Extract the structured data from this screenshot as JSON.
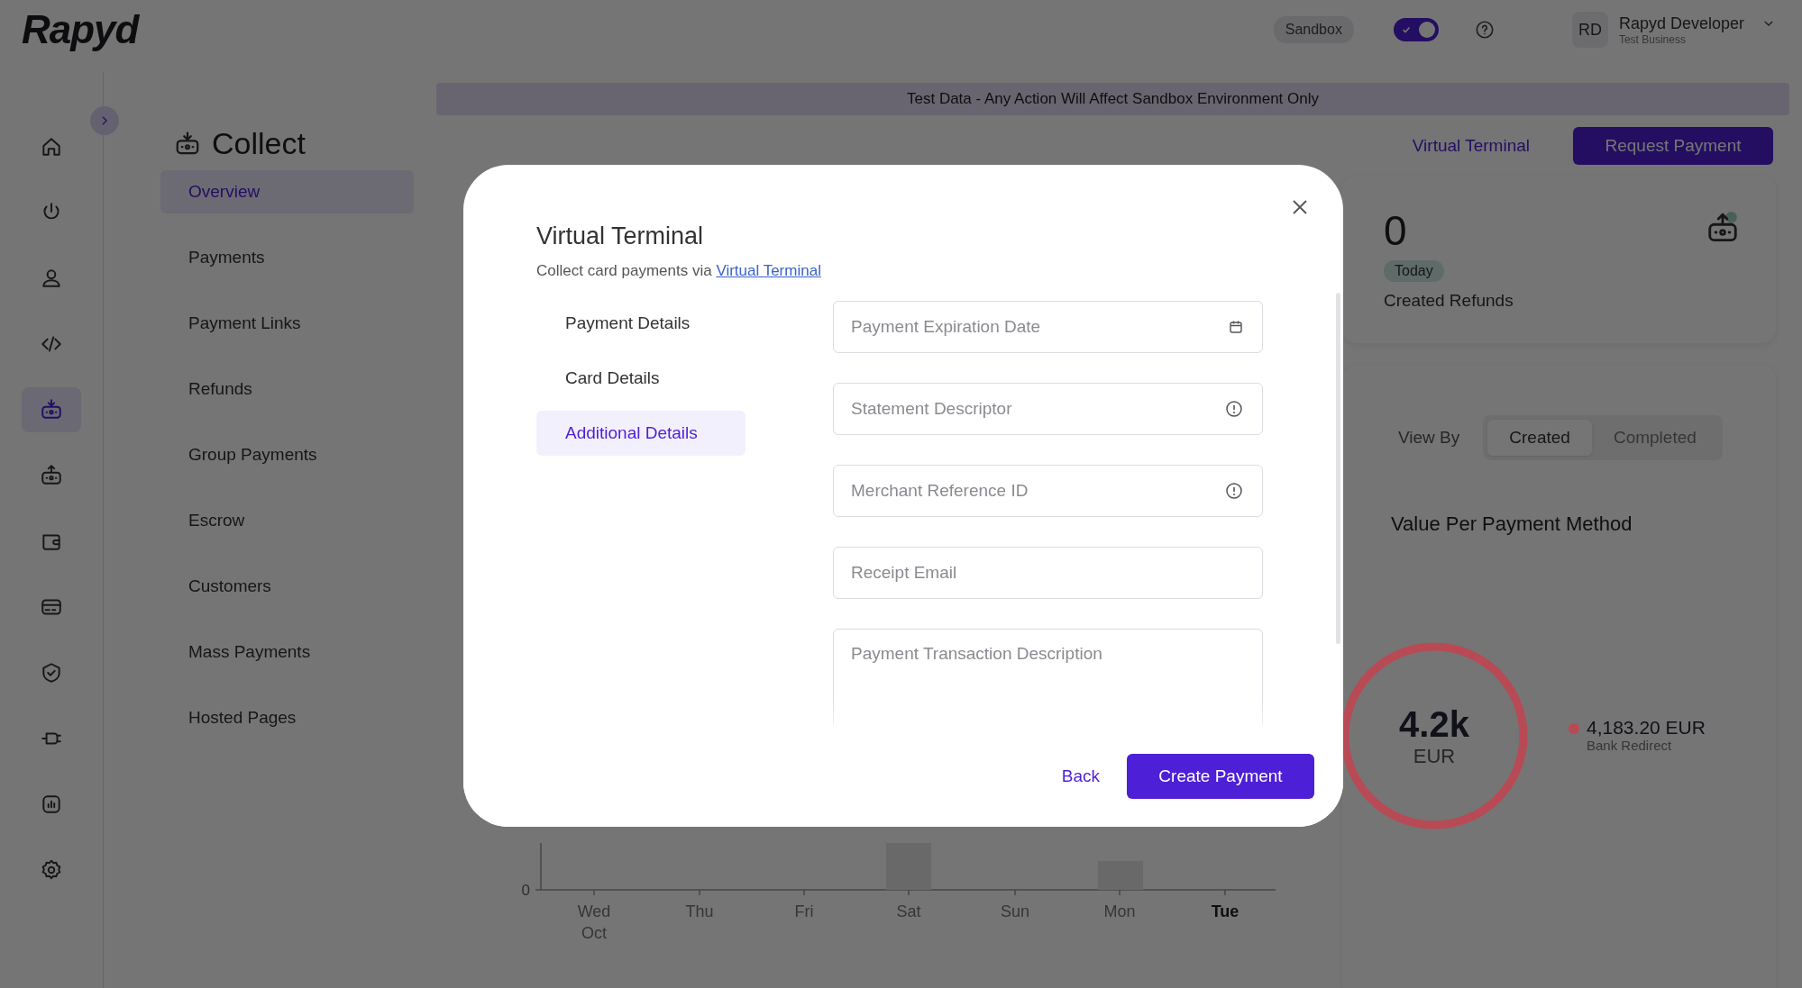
{
  "header": {
    "logo": "Rapyd",
    "environment_badge": "Sandbox",
    "sandbox_toggle": {
      "on": true
    },
    "user": {
      "initials": "RD",
      "name": "Rapyd Developer",
      "business": "Test Business"
    }
  },
  "nav_rail": {
    "items": [
      {
        "kind": "home",
        "selected": false
      },
      {
        "kind": "power",
        "selected": false
      },
      {
        "kind": "user",
        "selected": false
      },
      {
        "kind": "code",
        "selected": false
      },
      {
        "kind": "collect",
        "selected": true
      },
      {
        "kind": "disburse",
        "selected": false
      },
      {
        "kind": "wallet",
        "selected": false
      },
      {
        "kind": "card",
        "selected": false
      },
      {
        "kind": "shield",
        "selected": false
      },
      {
        "kind": "plug",
        "selected": false
      },
      {
        "kind": "report",
        "selected": false
      },
      {
        "kind": "settings",
        "selected": false
      }
    ]
  },
  "sidebar": {
    "title": "Collect",
    "items": [
      {
        "label": "Overview",
        "selected": true
      },
      {
        "label": "Payments",
        "selected": false
      },
      {
        "label": "Payment Links",
        "selected": false
      },
      {
        "label": "Refunds",
        "selected": false
      },
      {
        "label": "Group Payments",
        "selected": false
      },
      {
        "label": "Escrow",
        "selected": false
      },
      {
        "label": "Customers",
        "selected": false
      },
      {
        "label": "Mass Payments",
        "selected": false
      },
      {
        "label": "Hosted Pages",
        "selected": false
      }
    ]
  },
  "banner": "Test Data - Any Action Will Affect Sandbox Environment Only",
  "page_actions": {
    "link": "Virtual Terminal",
    "button": "Request Payment"
  },
  "refunds_card": {
    "value": "0",
    "badge": "Today",
    "label": "Created Refunds"
  },
  "view_by": {
    "label": "View By",
    "options": [
      {
        "label": "Created",
        "selected": true
      },
      {
        "label": "Completed",
        "selected": false
      }
    ]
  },
  "payment_method": {
    "title": "Value Per Payment Method",
    "total": "4.2k",
    "currency": "EUR",
    "legend": [
      {
        "amount": "4,183.20 EUR",
        "method": "Bank Redirect",
        "color": "#b84a55"
      }
    ]
  },
  "activity_chart": {
    "axis_label": "0",
    "days": [
      {
        "label": "Wed",
        "sub": "Oct",
        "current": false
      },
      {
        "label": "Thu",
        "current": false
      },
      {
        "label": "Fri",
        "current": false
      },
      {
        "label": "Sat",
        "current": false
      },
      {
        "label": "Sun",
        "current": false
      },
      {
        "label": "Mon",
        "current": false
      },
      {
        "label": "Tue",
        "current": true
      }
    ]
  },
  "modal": {
    "title": "Virtual Terminal",
    "subtitle": "Collect card payments via",
    "subtitle_link": "Virtual Terminal",
    "steps": [
      {
        "label": "Payment Details",
        "selected": false
      },
      {
        "label": "Card Details",
        "selected": false
      },
      {
        "label": "Additional Details",
        "selected": true
      }
    ],
    "fields": [
      {
        "kind": "date",
        "placeholder": "Payment Expiration Date"
      },
      {
        "kind": "info",
        "placeholder": "Statement Descriptor"
      },
      {
        "kind": "info",
        "placeholder": "Merchant Reference ID"
      },
      {
        "kind": "plain",
        "placeholder": "Receipt Email"
      },
      {
        "kind": "textarea",
        "placeholder": "Payment Transaction Description"
      }
    ],
    "back": "Back",
    "submit": "Create Payment"
  }
}
